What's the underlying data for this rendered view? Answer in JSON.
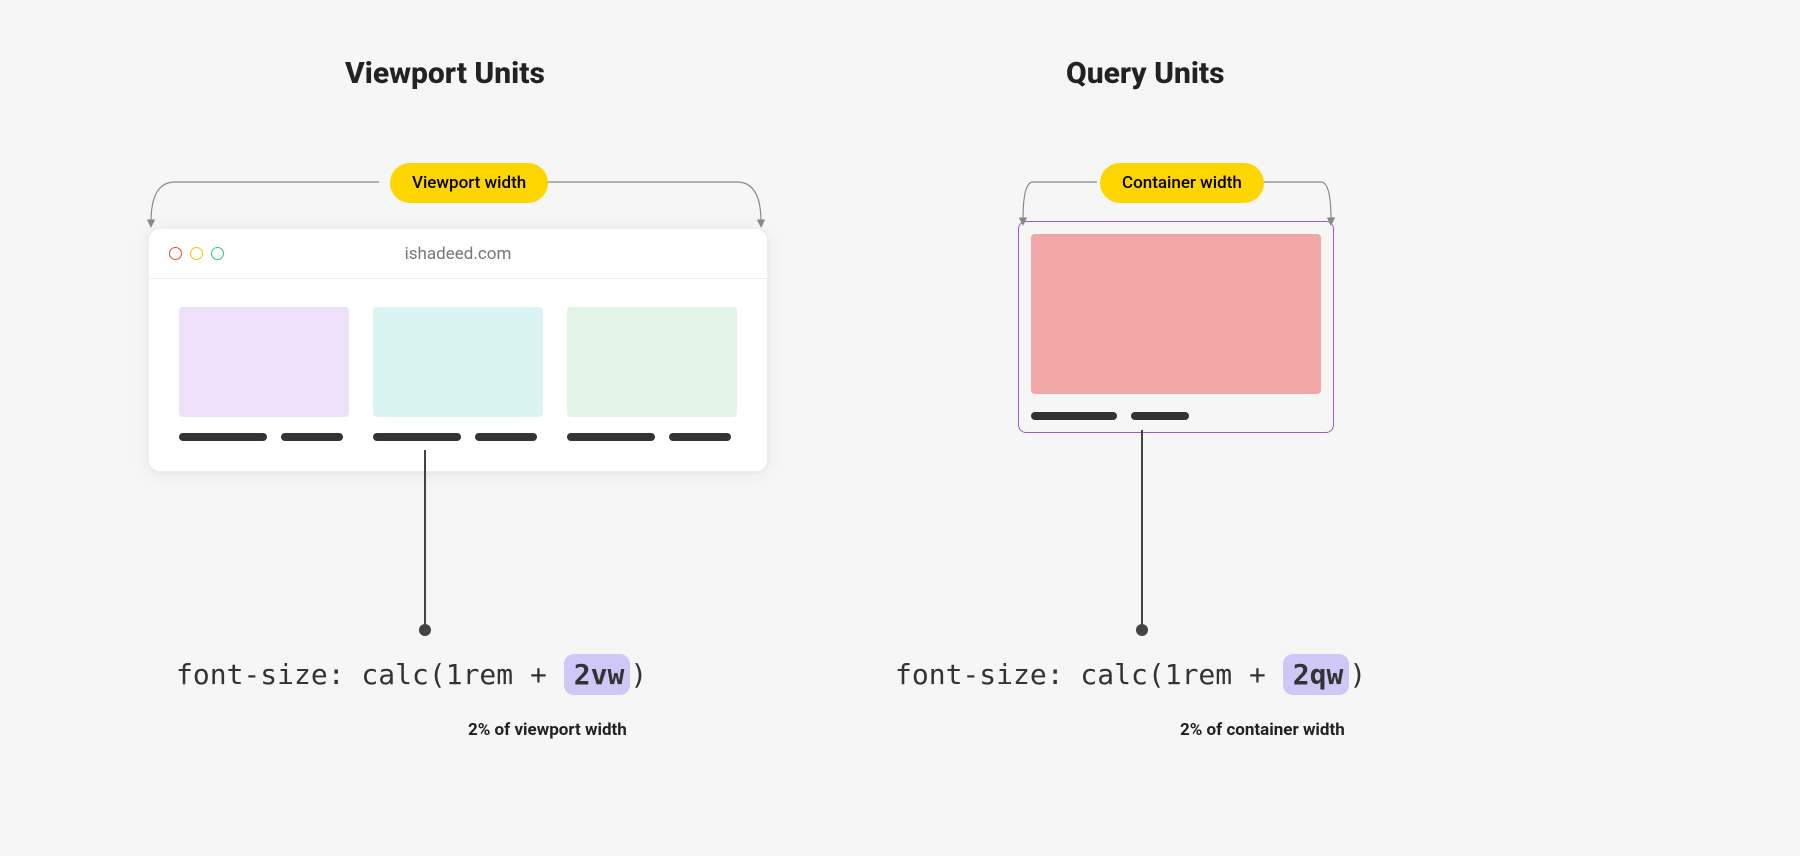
{
  "left": {
    "heading": "Viewport Units",
    "pill": "Viewport width",
    "url": "ishadeed.com",
    "code_prefix": "font-size: calc(1rem + ",
    "code_highlight": "2vw",
    "code_suffix": ")",
    "subcaption": "2% of viewport width"
  },
  "right": {
    "heading": "Query Units",
    "pill": "Container width",
    "code_prefix": "font-size: calc(1rem + ",
    "code_highlight": "2qw",
    "code_suffix": ")",
    "subcaption": "2% of container width"
  },
  "colors": {
    "pill_bg": "#ffd500",
    "highlight_bg": "#cfc8f7",
    "container_border": "#a259c6",
    "container_image": "#f0a7a5"
  }
}
